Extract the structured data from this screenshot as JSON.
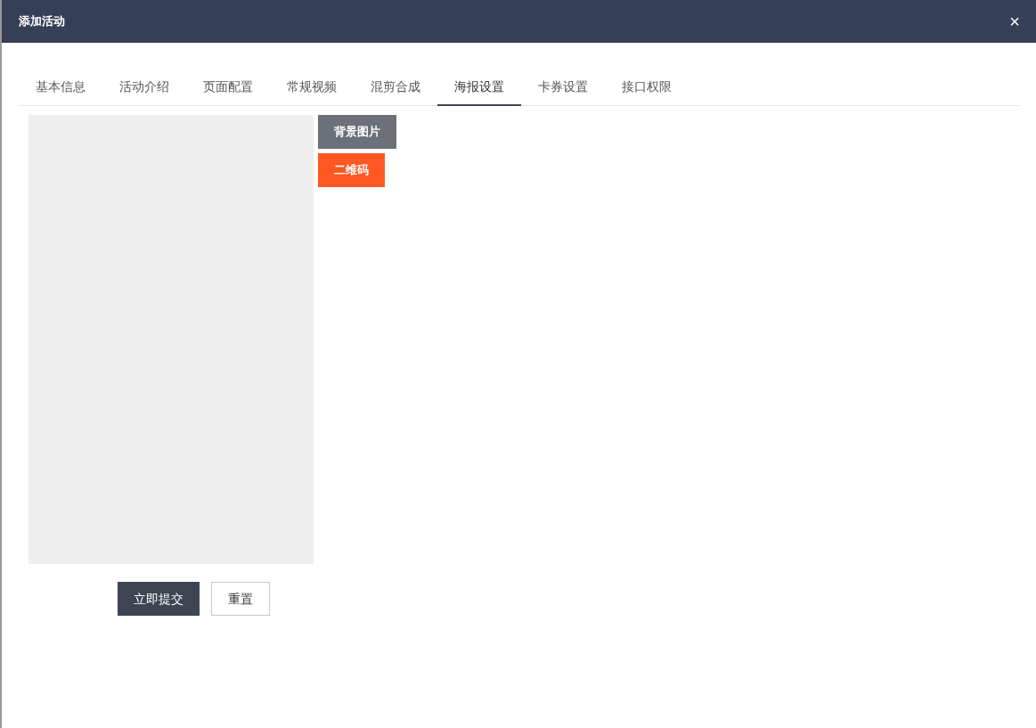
{
  "dialog": {
    "title": "添加活动",
    "close": "×"
  },
  "tabs": [
    {
      "label": "基本信息",
      "selected": false
    },
    {
      "label": "活动介绍",
      "selected": false
    },
    {
      "label": "页面配置",
      "selected": false
    },
    {
      "label": "常规视频",
      "selected": false
    },
    {
      "label": "混剪合成",
      "selected": false
    },
    {
      "label": "海报设置",
      "selected": true
    },
    {
      "label": "卡券设置",
      "selected": false
    },
    {
      "label": "接口权限",
      "selected": false
    }
  ],
  "poster_tools": [
    {
      "label": "背景图片",
      "color": "#6b7079"
    },
    {
      "label": "二维码",
      "color": "#ff5722"
    }
  ],
  "form_buttons": [
    {
      "label": "立即提交",
      "kind": "primary"
    },
    {
      "label": "重置",
      "kind": "default"
    }
  ]
}
